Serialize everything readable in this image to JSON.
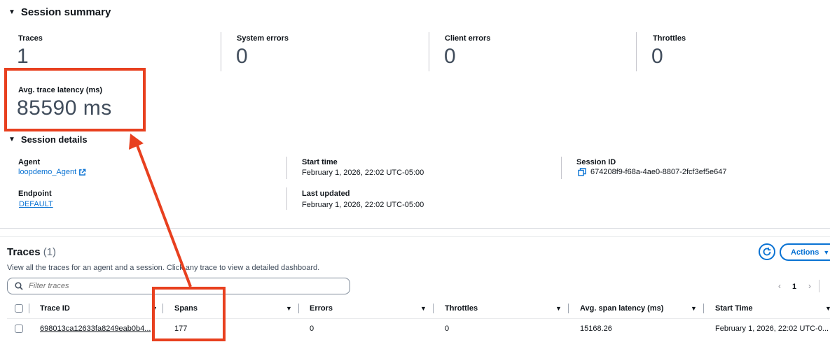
{
  "summary": {
    "title": "Session summary",
    "metrics": [
      {
        "label": "Traces",
        "value": "1"
      },
      {
        "label": "System errors",
        "value": "0"
      },
      {
        "label": "Client errors",
        "value": "0"
      },
      {
        "label": "Throttles",
        "value": "0"
      }
    ],
    "latency": {
      "label": "Avg. trace latency (ms)",
      "value": "85590 ms"
    }
  },
  "details": {
    "title": "Session details",
    "agent_label": "Agent",
    "agent_value": "loopdemo_Agent",
    "endpoint_label": "Endpoint",
    "endpoint_value": "DEFAULT",
    "start_label": "Start time",
    "start_value": "February 1, 2026, 22:02 UTC-05:00",
    "updated_label": "Last updated",
    "updated_value": "February 1, 2026, 22:02 UTC-05:00",
    "session_label": "Session ID",
    "session_value": "674208f9-f68a-4ae0-8807-2fcf3ef5e647"
  },
  "traces": {
    "title": "Traces",
    "count": "(1)",
    "description": "View all the traces for an agent and a session. Click any trace to view a detailed dashboard.",
    "search_placeholder": "Filter traces",
    "actions_label": "Actions",
    "page_current": "1",
    "columns": [
      "Trace ID",
      "Spans",
      "Errors",
      "Throttles",
      "Avg. span latency (ms)",
      "Start Time"
    ],
    "rows": [
      {
        "trace_id": "698013ca12633fa8249eab0b4...",
        "spans": "177",
        "errors": "0",
        "throttles": "0",
        "avg_latency": "15168.26",
        "start_time": "February 1, 2026, 22:02 UTC-0..."
      }
    ]
  },
  "colors": {
    "accent": "#0972d3",
    "annotation": "#e8401f"
  }
}
